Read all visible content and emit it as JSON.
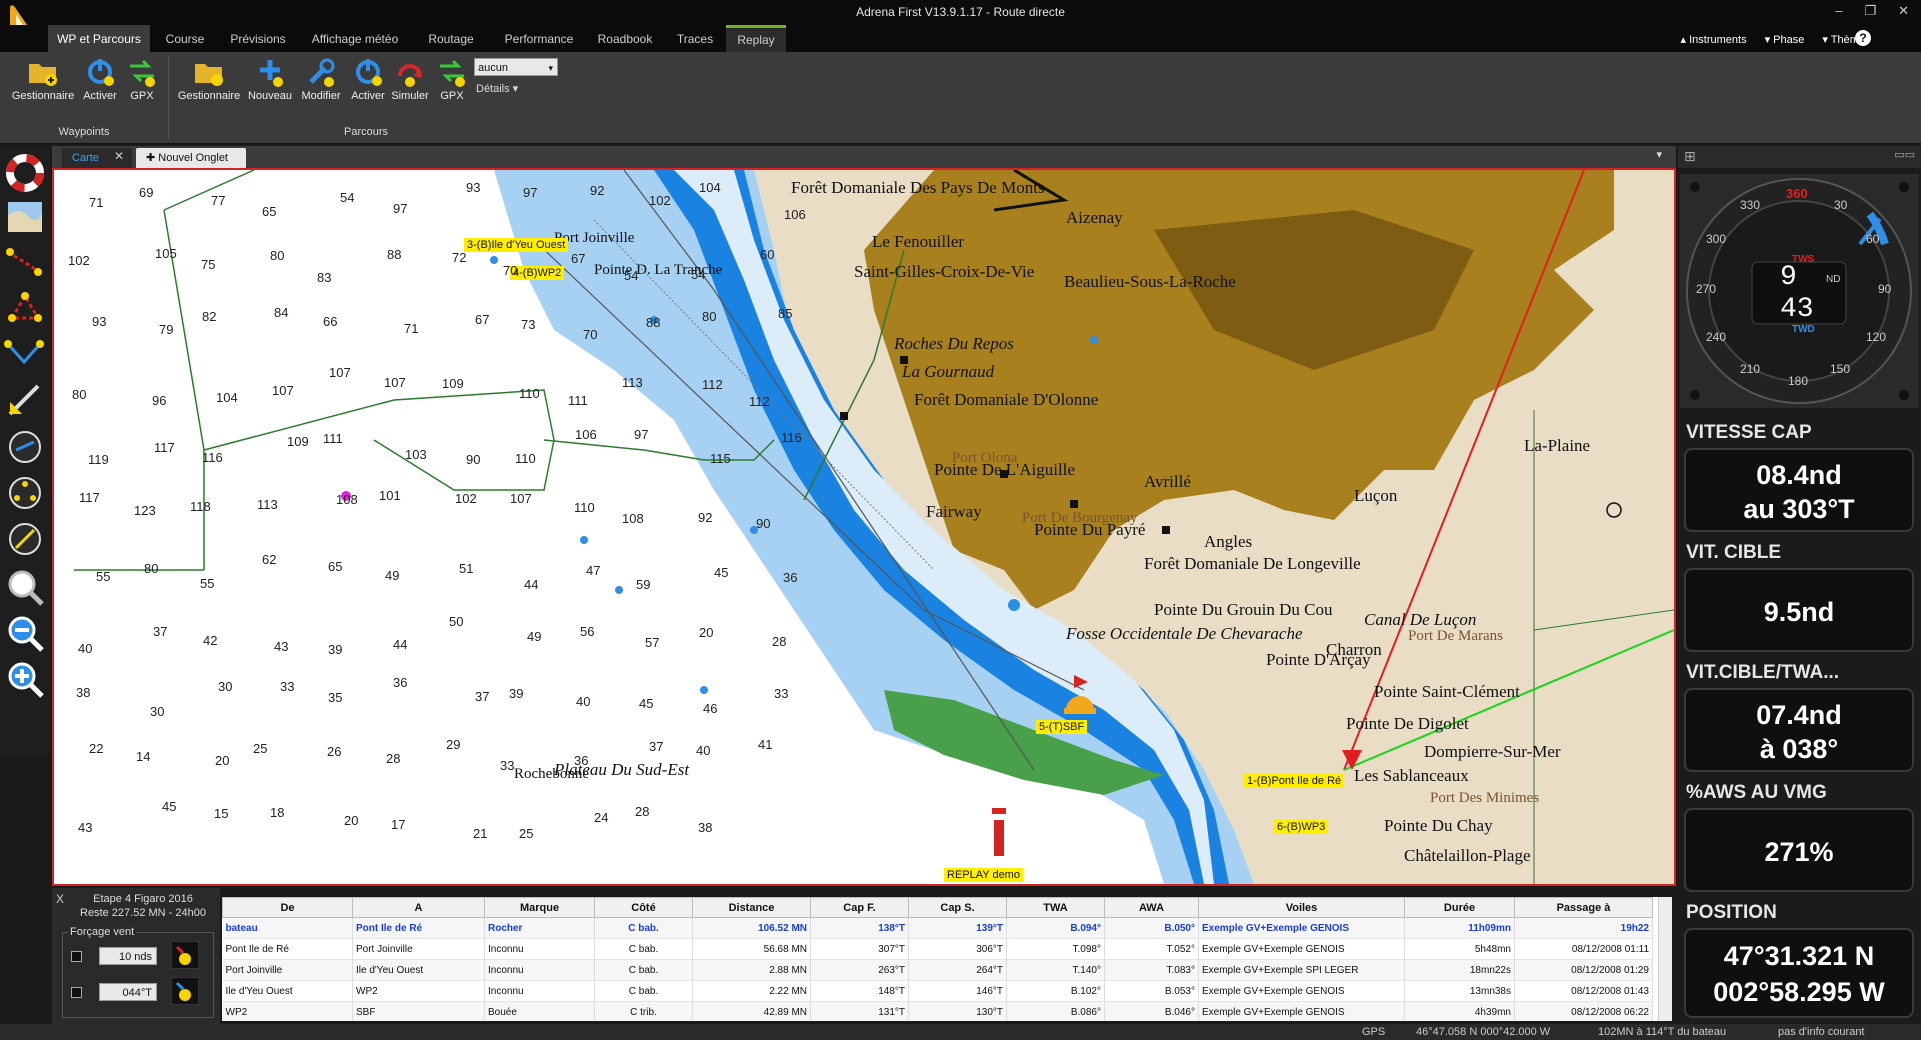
{
  "window": {
    "title": "Adrena First V13.9.1.17 - Route directe",
    "controls": [
      "–",
      "❐",
      "✕"
    ]
  },
  "menu": {
    "tabs": [
      "WP et Parcours",
      "Course",
      "Prévisions",
      "Affichage météo",
      "Routage",
      "Roadbook",
      "Traces",
      "Replay"
    ],
    "right": [
      "Instruments",
      "Phase",
      "Thème"
    ],
    "help": "?"
  },
  "ribbon": {
    "waypoints": {
      "label": "Waypoints",
      "buttons": [
        "Gestionnaire",
        "Activer",
        "GPX"
      ]
    },
    "parcours": {
      "label": "Parcours",
      "buttons": [
        "Gestionnaire",
        "Nouveau",
        "Modifier",
        "Activer",
        "Simuler",
        "GPX"
      ]
    },
    "select_value": "aucun",
    "details": "Détails"
  },
  "doc_tabs": {
    "carte": "Carte",
    "nouvel_onglet": "Nouvel Onglet"
  },
  "map": {
    "waypoint_labels": [
      "3-(B)Ile d'Yeu Ouest",
      "4-(B)WP2",
      "5-(T)SBF",
      "1-(B)Pont Ile de Ré",
      "6-(B)WP3",
      "REPLAY demo"
    ],
    "places": [
      "Forêt Domaniale Des Pays De Monts",
      "Aizenay",
      "Le Fenouiller",
      "Saint-Gilles-Croix-De-Vie",
      "Beaulieu-Sous-La-Roche",
      "Roches Du Repos",
      "La Gournaud",
      "Forêt Domaniale D'Olonne",
      "Pointe De L'Aiguille",
      "Avrillé",
      "Fairway",
      "Pointe Du Payré",
      "Angles",
      "Luçon",
      "La-Plaine",
      "Forêt Domaniale De Longeville",
      "Pointe Du Grouin Du Cou",
      "Canal De Luçon",
      "Port De Marans",
      "Fosse Occidentale De Chevarache",
      "Charron",
      "Pointe D'Arçay",
      "Pointe Saint-Clément",
      "Pointe De Digolet",
      "Dompierre-Sur-Mer",
      "Les Sablanceaux",
      "Port Des Minimes",
      "Pointe Du Chay",
      "Châtelaillon-Plage",
      "Plateau Du Sud-Est",
      "Rochebonne",
      "Pointe D. La Tranche",
      "Port Joinville",
      "Port De Bourgenay",
      "Port Olona"
    ],
    "depths": [
      "71",
      "69",
      "77",
      "65",
      "54",
      "97",
      "93",
      "97",
      "92",
      "102",
      "104",
      "106",
      "102",
      "105",
      "75",
      "80",
      "83",
      "88",
      "72",
      "70",
      "67",
      "54",
      "54",
      "60",
      "93",
      "79",
      "82",
      "84",
      "66",
      "71",
      "67",
      "73",
      "70",
      "88",
      "80",
      "85",
      "80",
      "96",
      "104",
      "107",
      "107",
      "107",
      "109",
      "110",
      "111",
      "113",
      "112",
      "112",
      "119",
      "117",
      "116",
      "109",
      "111",
      "103",
      "90",
      "110",
      "106",
      "97",
      "115",
      "116",
      "117",
      "123",
      "118",
      "113",
      "108",
      "101",
      "102",
      "107",
      "110",
      "108",
      "92",
      "90",
      "55",
      "80",
      "55",
      "62",
      "65",
      "49",
      "51",
      "44",
      "47",
      "59",
      "45",
      "36",
      "40",
      "37",
      "42",
      "43",
      "39",
      "44",
      "50",
      "49",
      "56",
      "57",
      "20",
      "28",
      "38",
      "30",
      "30",
      "33",
      "35",
      "36",
      "37",
      "39",
      "40",
      "45",
      "46",
      "33",
      "22",
      "14",
      "20",
      "25",
      "26",
      "28",
      "29",
      "33",
      "36",
      "37",
      "40",
      "41",
      "43",
      "45",
      "15",
      "18",
      "20",
      "17",
      "21",
      "25",
      "24",
      "28",
      "38"
    ]
  },
  "instruments": {
    "compass": {
      "tws_label": "TWS",
      "tws": "9",
      "twd": "43",
      "twd_label": "TWD",
      "unit": "ND",
      "ticks": [
        "360",
        "30",
        "60",
        "90",
        "120",
        "150",
        "180",
        "210",
        "240",
        "270",
        "300",
        "330"
      ]
    },
    "panels": [
      {
        "title": "VITESSE CAP",
        "lines": [
          "08.4nd",
          "au 303°T"
        ]
      },
      {
        "title": "VIT. CIBLE",
        "lines": [
          "9.5nd"
        ]
      },
      {
        "title": "VIT.CIBLE/TWA...",
        "lines": [
          "07.4nd",
          "à 038°"
        ]
      },
      {
        "title": "%AWS AU VMG",
        "lines": [
          "271%"
        ]
      },
      {
        "title": "POSITION",
        "lines": [
          "47°31.321 N",
          "002°58.295 W"
        ]
      }
    ]
  },
  "route_panel": {
    "close": "X",
    "etape": "Etape 4 Figaro 2016",
    "reste": "Reste 227.52 MN - 24h00",
    "forcage_label": "Forçage vent",
    "wind_speed": "10 nds",
    "wind_dir": "044°T"
  },
  "route_table": {
    "headers": [
      "De",
      "A",
      "Marque",
      "Côté",
      "Distance",
      "Cap F.",
      "Cap S.",
      "TWA",
      "AWA",
      "Voiles",
      "Durée",
      "Passage à"
    ],
    "rows": [
      [
        "bateau",
        "Pont Ile de Ré",
        "Rocher",
        "C bab.",
        "106.52 MN",
        "138°T",
        "139°T",
        "B.094°",
        "B.050°",
        "Exemple GV+Exemple GENOIS",
        "11h09mn",
        "19h22"
      ],
      [
        "Pont Ile de Ré",
        "Port Joinville",
        "Inconnu",
        "C bab.",
        "56.68 MN",
        "307°T",
        "306°T",
        "T.098°",
        "T.052°",
        "Exemple GV+Exemple GENOIS",
        "5h48mn",
        "08/12/2008 01:11"
      ],
      [
        "Port Joinville",
        "Ile d'Yeu Ouest",
        "Inconnu",
        "C bab.",
        "2.88 MN",
        "263°T",
        "264°T",
        "T.140°",
        "T.083°",
        "Exemple GV+Exemple SPI LEGER",
        "18mn22s",
        "08/12/2008 01:29"
      ],
      [
        "Ile d'Yeu Ouest",
        "WP2",
        "Inconnu",
        "C bab.",
        "2.22 MN",
        "148°T",
        "146°T",
        "B.102°",
        "B.053°",
        "Exemple GV+Exemple GENOIS",
        "13mn38s",
        "08/12/2008 01:43"
      ],
      [
        "WP2",
        "SBF",
        "Bouée",
        "C trib.",
        "42.89 MN",
        "131°T",
        "130°T",
        "B.086°",
        "B.046°",
        "Exemple GV+Exemple GENOIS",
        "4h39mn",
        "08/12/2008 06:22"
      ]
    ]
  },
  "status": {
    "gps": "GPS",
    "coords": "46°47.058 N  000°42.000 W",
    "bearing": "102MN à 114°T du bateau",
    "info": "pas d'info courant"
  },
  "colors": {
    "land_dark": "#a8801e",
    "land_light": "#e9ddc6",
    "shallow": "#a6d1f2",
    "deep_shallow": "#1a82e0",
    "accent": "#6fb12e",
    "route_red": "#e02020",
    "route_green": "#19d419"
  }
}
